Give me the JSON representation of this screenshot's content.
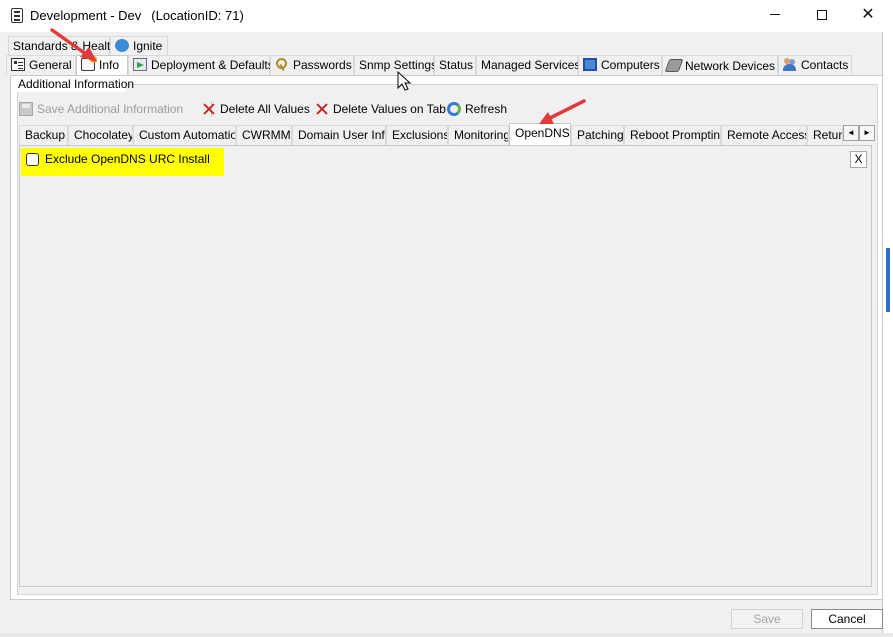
{
  "window": {
    "title": "Development - Dev",
    "location_label": "(LocationID: 71)",
    "controls": {
      "minimize": "minimize",
      "maximize": "maximize",
      "close": "✕"
    }
  },
  "top_tabs": {
    "row1": [
      "Standards & Health",
      "Ignite"
    ],
    "row2": [
      "General",
      "Info",
      "Deployment & Defaults",
      "Passwords",
      "Snmp Settings",
      "Status",
      "Managed Services",
      "Computers",
      "Network Devices",
      "Contacts"
    ],
    "selected": "Info"
  },
  "group": {
    "legend": "Additional Information"
  },
  "toolbar": {
    "save_label": "Save Additional Information",
    "delete_all_label": "Delete All Values",
    "delete_tab_label": "Delete Values on Tab",
    "refresh_label": "Refresh"
  },
  "inner_tabs": {
    "items": [
      "Backup",
      "Chocolatey",
      "Custom Automation",
      "CWRMM",
      "Domain User Info",
      "Exclusions",
      "Monitoring",
      "OpenDNS",
      "Patching",
      "Reboot Prompting",
      "Remote Access",
      "Return"
    ],
    "selected": "OpenDNS",
    "scroll_left": "◄",
    "scroll_right": "►"
  },
  "tab_page": {
    "checkbox_label": "Exclude OpenDNS URC Install",
    "checkbox_checked": false,
    "close_label": "X",
    "highlight_color": "#ffff00"
  },
  "footer": {
    "save_label": "Save",
    "cancel_label": "Cancel"
  },
  "colors": {
    "annotation_arrow": "#e03a3a",
    "highlight": "#ffff00"
  }
}
